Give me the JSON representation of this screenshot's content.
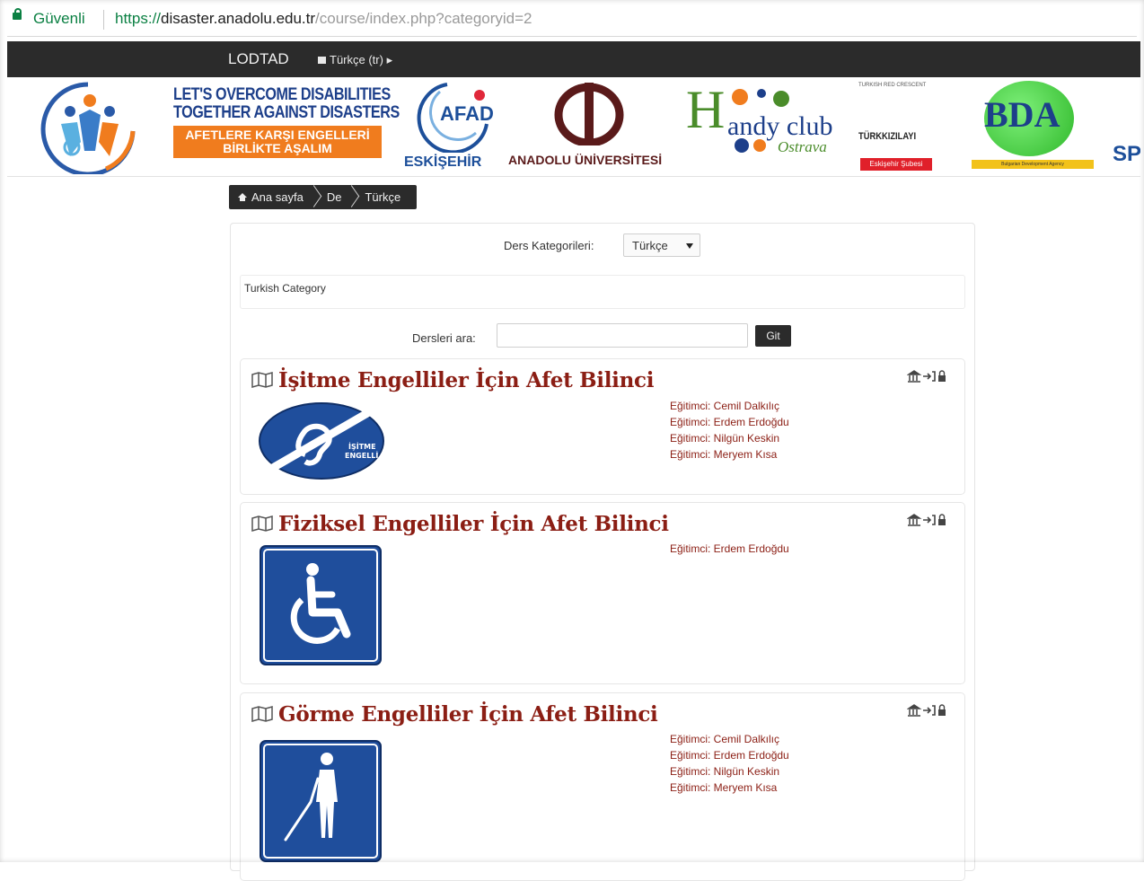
{
  "browser": {
    "secure_label": "Güvenli",
    "url_scheme": "https://",
    "url_host": "disaster.anadolu.edu.tr",
    "url_path": "/course/index.php?categoryid=2"
  },
  "navbar": {
    "brand": "LODTAD",
    "language": "Türkçe (tr)"
  },
  "logos": {
    "slogan_en_line1": "LET'S OVERCOME  DISABILITIES",
    "slogan_en_line2": "TOGETHER AGAINST DISASTERS",
    "slogan_tr_line1": "AFETLERE KARŞI ENGELLERİ",
    "slogan_tr_line2": "BİRLİKTE AŞALIM",
    "afad_name": "AFAD",
    "afad_city": "ESKİŞEHİR",
    "anadolu": "ANADOLU ÜNİVERSİTESİ",
    "handy_h": "H",
    "handy_rest": "andy club",
    "handy_city": "Ostrava",
    "kizilay_top": "TURKISH RED CRESCENT",
    "kizilay_name": "TÜRKKIZILAYI",
    "kizilay_branch": "Eskişehir Şubesi",
    "bda": "BDA",
    "bda_sub": "Bulgarian Development Agency",
    "spo": "SPO"
  },
  "breadcrumb": {
    "home": "Ana sayfa",
    "item2": "De",
    "item3": "Türkçe"
  },
  "panel": {
    "category_label": "Ders Kategorileri:",
    "category_value": "Türkçe",
    "category_description": "Turkish Category",
    "search_label": "Dersleri ara:",
    "search_value": "",
    "search_button": "Git"
  },
  "courses": [
    {
      "title": "İşitme Engelliler İçin Afet Bilinci",
      "image_text_line1": "İŞİTME",
      "image_text_line2": "ENGELLİ",
      "teachers": [
        "Eğitimci: Cemil Dalkılıç",
        "Eğitimci: Erdem Erdoğdu",
        "Eğitimci: Nilgün Keskin",
        "Eğitimci: Meryem Kısa"
      ]
    },
    {
      "title": "Fiziksel Engelliler İçin Afet Bilinci",
      "teachers": [
        "Eğitimci: Erdem Erdoğdu"
      ]
    },
    {
      "title": "Görme Engelliler İçin Afet Bilinci",
      "teachers": [
        "Eğitimci: Cemil Dalkılıç",
        "Eğitimci: Erdem Erdoğdu",
        "Eğitimci: Nilgün Keskin",
        "Eğitimci: Meryem Kısa"
      ]
    }
  ],
  "colors": {
    "accent_dark": "#2b2b2b",
    "course_title": "#8b1e14",
    "secure_green": "#0b8043",
    "sign_blue": "#1f4e9c"
  },
  "icons": [
    "lock-icon",
    "flag-icon",
    "home-icon",
    "map-icon",
    "guest-access-icon",
    "self-enrol-icon",
    "lock-icon"
  ]
}
